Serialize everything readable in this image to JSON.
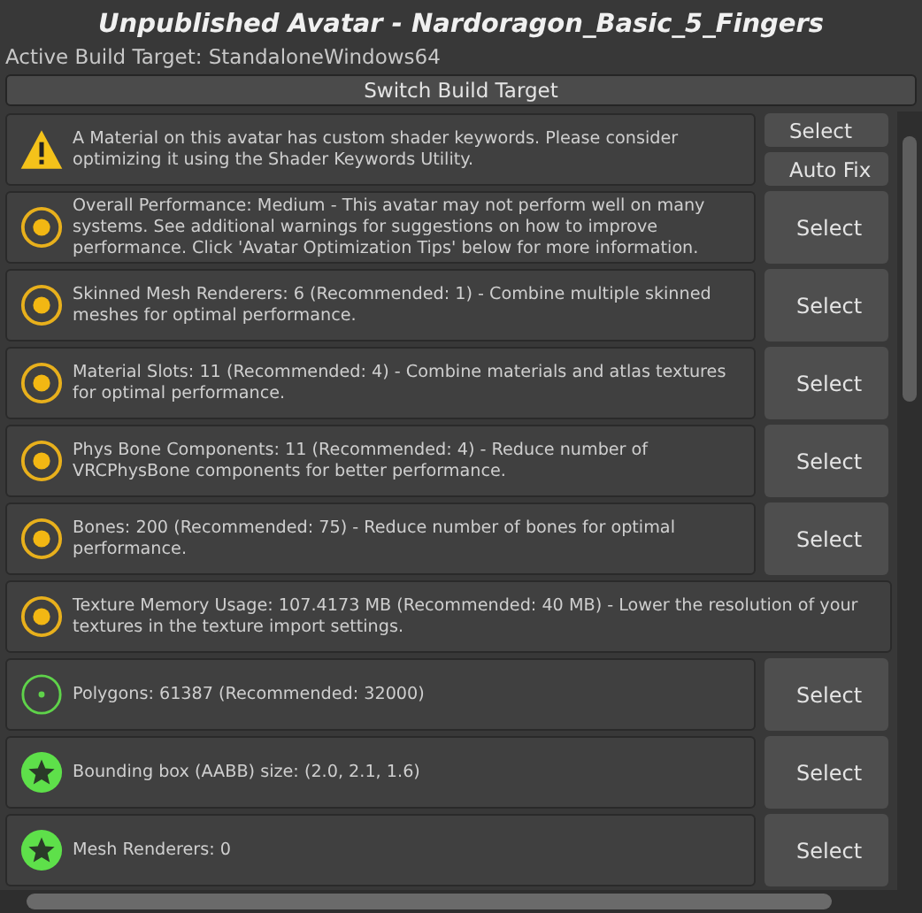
{
  "window": {
    "title": "Unpublished Avatar - Nardoragon_Basic_5_Fingers"
  },
  "build_target": "Active Build Target: StandaloneWindows64",
  "switch_button": "Switch Build Target",
  "messages": [
    {
      "kind": "warning",
      "text": "A Material on this avatar has custom shader keywords. Please consider optimizing it using the Shader Keywords Utility.",
      "buttons": [
        "Select",
        "Auto Fix"
      ]
    },
    {
      "kind": "medium",
      "text": "Overall Performance: Medium - This avatar may not perform well on many systems. See additional warnings for suggestions on how to improve performance. Click 'Avatar Optimization Tips' below for more information.",
      "buttons": [
        "Select"
      ]
    },
    {
      "kind": "medium",
      "text": "Skinned Mesh Renderers: 6 (Recommended: 1) - Combine multiple skinned meshes for optimal performance.",
      "buttons": [
        "Select"
      ]
    },
    {
      "kind": "medium",
      "text": "Material Slots: 11 (Recommended: 4) - Combine materials and atlas textures for optimal performance.",
      "buttons": [
        "Select"
      ]
    },
    {
      "kind": "medium",
      "text": "Phys Bone Components: 11 (Recommended: 4) - Reduce number of VRCPhysBone components for better performance.",
      "buttons": [
        "Select"
      ]
    },
    {
      "kind": "medium",
      "text": "Bones: 200 (Recommended: 75) - Reduce number of bones for optimal performance.",
      "buttons": [
        "Select"
      ]
    },
    {
      "kind": "medium",
      "text": "Texture Memory Usage: 107.4173 MB (Recommended: 40 MB) - Lower the resolution of your textures in the texture import settings."
    },
    {
      "kind": "good",
      "text": "Polygons: 61387 (Recommended: 32000)",
      "buttons": [
        "Select"
      ]
    },
    {
      "kind": "excellent",
      "text": "Bounding box (AABB) size: (2.0, 2.1, 1.6)",
      "buttons": [
        "Select"
      ]
    },
    {
      "kind": "excellent",
      "text": "Mesh Renderers: 0",
      "buttons": [
        "Select"
      ]
    }
  ]
}
